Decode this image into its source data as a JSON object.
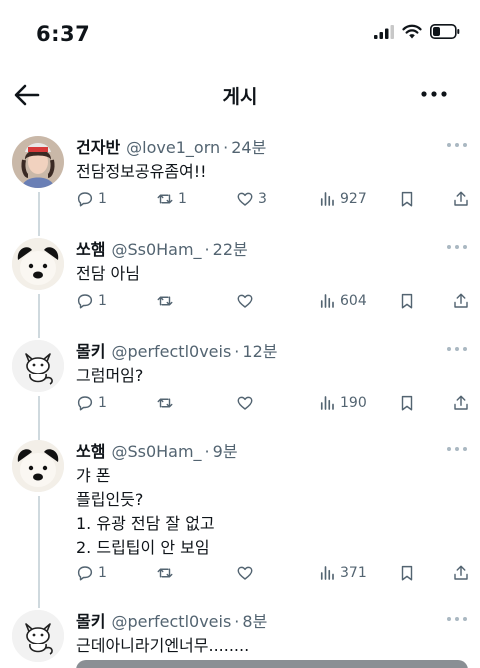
{
  "status_bar": {
    "time": "6:37"
  },
  "header": {
    "title": "게시"
  },
  "tweets": [
    {
      "name": "건자반",
      "handle": "@love1_orn",
      "time": "24분",
      "lines": [
        "전담정보공유좀여!!"
      ],
      "replies": "1",
      "retweets": "1",
      "likes": "3",
      "views": "927"
    },
    {
      "name": "쏘햄",
      "handle": "@Ss0Ham_",
      "time": "22분",
      "lines": [
        "전담 아님"
      ],
      "replies": "1",
      "retweets": "",
      "likes": "",
      "views": "604"
    },
    {
      "name": "몰키",
      "handle": "@perfectl0veis",
      "time": "12분",
      "lines": [
        "그럼머임?"
      ],
      "replies": "1",
      "retweets": "",
      "likes": "",
      "views": "190"
    },
    {
      "name": "쏘햄",
      "handle": "@Ss0Ham_",
      "time": "9분",
      "lines": [
        "갸 폰",
        "플립인듯?",
        "1. 유광 전담 잘 없고",
        "2. 드립팁이 안 보임"
      ],
      "replies": "1",
      "retweets": "",
      "likes": "",
      "views": "371"
    },
    {
      "name": "몰키",
      "handle": "@perfectl0veis",
      "time": "8분",
      "lines": [
        "근데아니라기엔너무........"
      ]
    }
  ]
}
